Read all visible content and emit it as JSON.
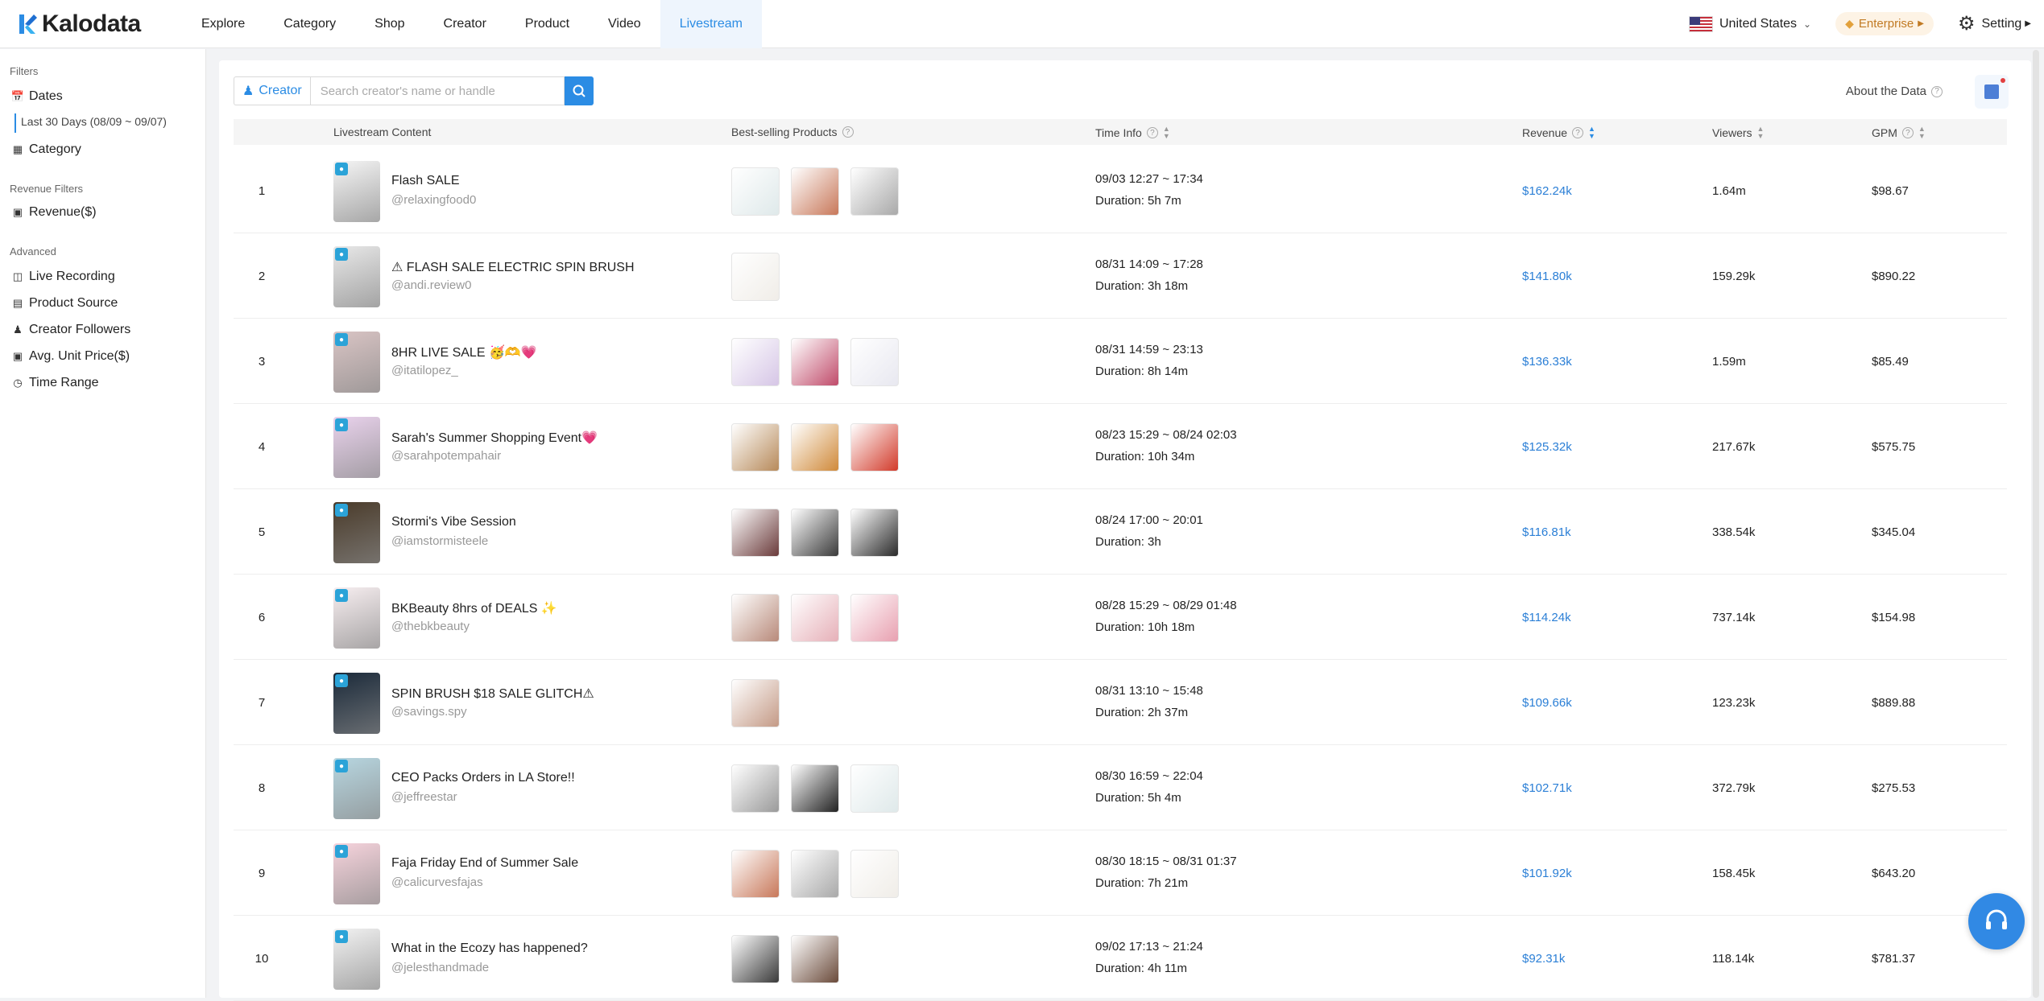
{
  "brand": {
    "name": "Kalodata",
    "accent": "#2b8ce4"
  },
  "nav": {
    "items": [
      {
        "label": "Explore"
      },
      {
        "label": "Category"
      },
      {
        "label": "Shop"
      },
      {
        "label": "Creator"
      },
      {
        "label": "Product"
      },
      {
        "label": "Video"
      },
      {
        "label": "Livestream"
      }
    ],
    "active": "Livestream"
  },
  "header": {
    "country": "United States",
    "plan": "Enterprise",
    "setting": "Setting"
  },
  "sidebar": {
    "filters_title": "Filters",
    "dates_label": "Dates",
    "dates_range": "Last 30 Days (08/09 ~ 09/07)",
    "category_label": "Category",
    "revenue_filters_title": "Revenue Filters",
    "revenue_label": "Revenue($)",
    "advanced_title": "Advanced",
    "advanced_items": [
      {
        "label": "Live Recording",
        "icon": "video-icon"
      },
      {
        "label": "Product Source",
        "icon": "box-icon"
      },
      {
        "label": "Creator Followers",
        "icon": "user-icon"
      },
      {
        "label": "Avg. Unit Price($)",
        "icon": "dollar-icon"
      },
      {
        "label": "Time Range",
        "icon": "clock-icon"
      }
    ]
  },
  "search": {
    "type_label": "Creator",
    "placeholder": "Search creator's name or handle"
  },
  "about_data": "About the Data",
  "table": {
    "headers": {
      "content": "Livestream Content",
      "products": "Best-selling Products",
      "time": "Time Info",
      "revenue": "Revenue",
      "viewers": "Viewers",
      "gpm": "GPM"
    },
    "rows": [
      {
        "rank": "1",
        "title": "Flash SALE",
        "handle": "@relaxingfood0",
        "time": "09/03 12:27 ~ 17:34",
        "duration": "Duration: 5h 7m",
        "revenue": "$162.24k",
        "viewers": "1.64m",
        "gpm": "$98.67",
        "products": 3
      },
      {
        "rank": "2",
        "title": "⚠ FLASH SALE ELECTRIC SPIN BRUSH",
        "handle": "@andi.review0",
        "time": "08/31 14:09 ~ 17:28",
        "duration": "Duration: 3h 18m",
        "revenue": "$141.80k",
        "viewers": "159.29k",
        "gpm": "$890.22",
        "products": 1
      },
      {
        "rank": "3",
        "title": "8HR LIVE SALE 🥳🫶💗",
        "handle": "@itatilopez_",
        "time": "08/31 14:59 ~ 23:13",
        "duration": "Duration: 8h 14m",
        "revenue": "$136.33k",
        "viewers": "1.59m",
        "gpm": "$85.49",
        "products": 3
      },
      {
        "rank": "4",
        "title": "Sarah's Summer Shopping Event💗",
        "handle": "@sarahpotempahair",
        "time": "08/23 15:29 ~ 08/24 02:03",
        "duration": "Duration: 10h 34m",
        "revenue": "$125.32k",
        "viewers": "217.67k",
        "gpm": "$575.75",
        "products": 3
      },
      {
        "rank": "5",
        "title": "Stormi's Vibe Session",
        "handle": "@iamstormisteele",
        "time": "08/24 17:00 ~ 20:01",
        "duration": "Duration: 3h",
        "revenue": "$116.81k",
        "viewers": "338.54k",
        "gpm": "$345.04",
        "products": 3
      },
      {
        "rank": "6",
        "title": "BKBeauty 8hrs of DEALS ✨",
        "handle": "@thebkbeauty",
        "time": "08/28 15:29 ~ 08/29 01:48",
        "duration": "Duration: 10h 18m",
        "revenue": "$114.24k",
        "viewers": "737.14k",
        "gpm": "$154.98",
        "products": 3
      },
      {
        "rank": "7",
        "title": "SPIN BRUSH $18 SALE GLITCH⚠",
        "handle": "@savings.spy",
        "time": "08/31 13:10 ~ 15:48",
        "duration": "Duration: 2h 37m",
        "revenue": "$109.66k",
        "viewers": "123.23k",
        "gpm": "$889.88",
        "products": 1
      },
      {
        "rank": "8",
        "title": "CEO Packs Orders in LA Store!!",
        "handle": "@jeffreestar",
        "time": "08/30 16:59 ~ 22:04",
        "duration": "Duration: 5h 4m",
        "revenue": "$102.71k",
        "viewers": "372.79k",
        "gpm": "$275.53",
        "products": 3
      },
      {
        "rank": "9",
        "title": "Faja Friday End of Summer Sale",
        "handle": "@calicurvesfajas",
        "time": "08/30 18:15 ~ 08/31 01:37",
        "duration": "Duration: 7h 21m",
        "revenue": "$101.92k",
        "viewers": "158.45k",
        "gpm": "$643.20",
        "products": 3
      },
      {
        "rank": "10",
        "title": "What in the Ecozy has happened?",
        "handle": "@jelesthandmade",
        "time": "09/02 17:13 ~ 21:24",
        "duration": "Duration: 4h 11m",
        "revenue": "$92.31k",
        "viewers": "118.14k",
        "gpm": "$781.37",
        "products": 2
      }
    ]
  }
}
